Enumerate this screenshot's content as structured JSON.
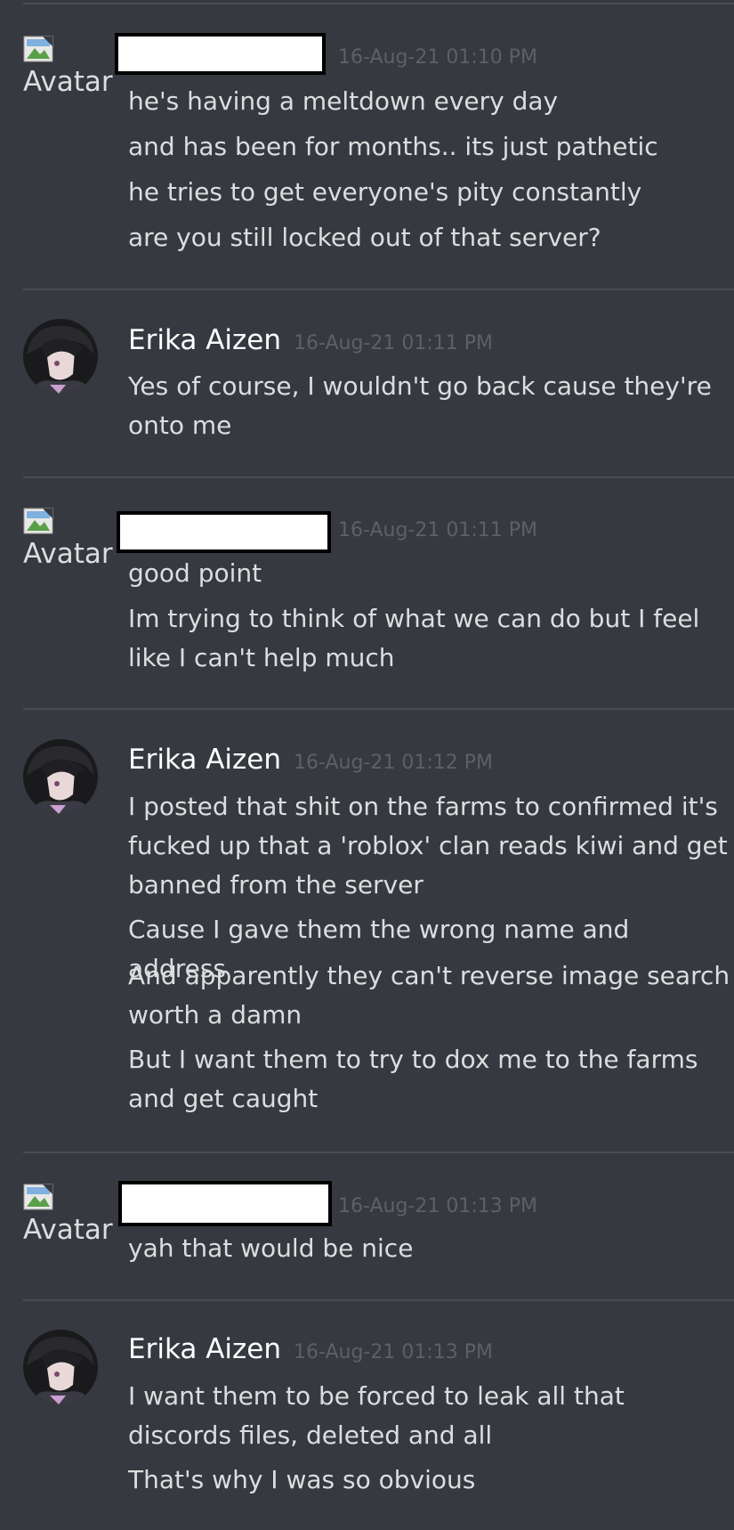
{
  "avatar_alt": "Avatar",
  "messages": [
    {
      "author": "",
      "timestamp": "16-Aug-21 01:10 PM",
      "lines": [
        "he's having a meltdown every day",
        "and has been for months.. its just pathetic",
        "he tries to get everyone's pity constantly",
        "are you still locked out of that server?"
      ]
    },
    {
      "author": "Erika Aizen",
      "timestamp": "16-Aug-21 01:11 PM",
      "lines": [
        "Yes of course, I wouldn't go back cause they're onto me"
      ]
    },
    {
      "author": "",
      "timestamp": "16-Aug-21 01:11 PM",
      "lines": [
        "good point",
        "Im trying to think of what we can do but I feel like I can't help much"
      ]
    },
    {
      "author": "Erika Aizen",
      "timestamp": "16-Aug-21 01:12 PM",
      "lines": [
        "I posted that shit on the farms to confirmed it's fucked up that a 'roblox' clan reads kiwi and get banned from the server",
        "Cause I gave them the wrong name and address",
        "And apparently they can't reverse image search worth a damn",
        "But I want them to try to dox me to the farms and get caught"
      ]
    },
    {
      "author": "",
      "timestamp": "16-Aug-21 01:13 PM",
      "lines": [
        "yah that would be nice"
      ]
    },
    {
      "author": "Erika Aizen",
      "timestamp": "16-Aug-21 01:13 PM",
      "lines": [
        "I want them to be forced to leak all that discords files, deleted and all",
        "That's why I was so obvious"
      ]
    }
  ]
}
